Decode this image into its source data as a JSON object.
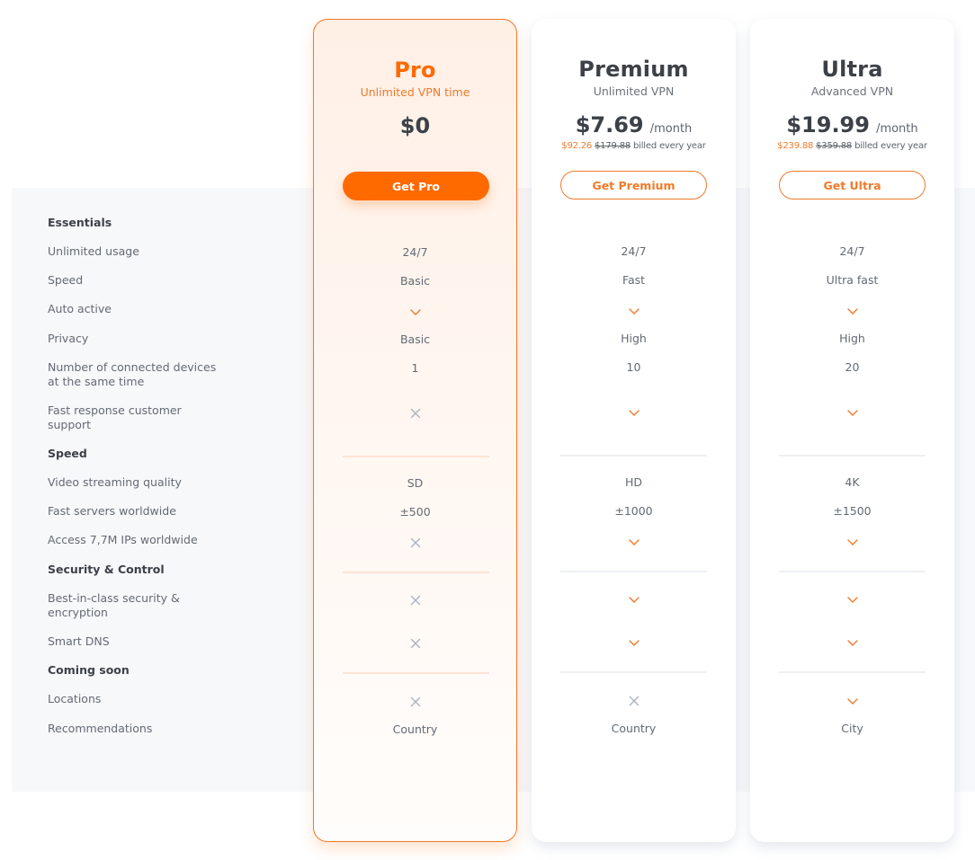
{
  "features": {
    "sections": [
      {
        "title": "Essentials",
        "rows": [
          {
            "label": "Unlimited usage"
          },
          {
            "label": "Speed"
          },
          {
            "label": "Auto active"
          },
          {
            "label": "Privacy"
          },
          {
            "label": "Number of connected devices at the same time"
          },
          {
            "label": "Fast response customer support"
          }
        ]
      },
      {
        "title": "Speed",
        "rows": [
          {
            "label": "Video streaming quality"
          },
          {
            "label": "Fast servers worldwide"
          },
          {
            "label": "Access 7,7M IPs worldwide"
          }
        ]
      },
      {
        "title": "Security & Control",
        "rows": [
          {
            "label": "Best-in-class security & encryption"
          },
          {
            "label": "Smart DNS"
          }
        ]
      },
      {
        "title": "Coming soon",
        "rows": [
          {
            "label": "Locations"
          },
          {
            "label": "Recommendations"
          }
        ]
      }
    ]
  },
  "plans": [
    {
      "name": "Pro",
      "subtitle": "Unlimited VPN time",
      "price": "$0",
      "per": "",
      "billing_sale": "",
      "billing_original": "",
      "billing_suffix": "",
      "cta": "Get Pro",
      "featured": true,
      "values": [
        "24/7",
        "Basic",
        "check-icon",
        "Basic",
        "1",
        "x-icon",
        "SD",
        "±500",
        "x-icon",
        "x-icon",
        "x-icon",
        "x-icon",
        "Country"
      ]
    },
    {
      "name": "Premium",
      "subtitle": "Unlimited VPN",
      "price": "$7.69",
      "per": "/month",
      "billing_sale": "$92.26",
      "billing_original": "$179.88",
      "billing_suffix": "billed every year",
      "cta": "Get Premium",
      "featured": false,
      "values": [
        "24/7",
        "Fast",
        "check-icon",
        "High",
        "10",
        "check-icon",
        "HD",
        "±1000",
        "check-icon",
        "check-icon",
        "check-icon",
        "x-icon",
        "Country"
      ]
    },
    {
      "name": "Ultra",
      "subtitle": "Advanced VPN",
      "price": "$19.99",
      "per": "/month",
      "billing_sale": "$239.88",
      "billing_original": "$359.88",
      "billing_suffix": "billed every year",
      "cta": "Get Ultra",
      "featured": false,
      "values": [
        "24/7",
        "Ultra fast",
        "check-icon",
        "High",
        "20",
        "check-icon",
        "4K",
        "±1500",
        "check-icon",
        "check-icon",
        "check-icon",
        "check-icon",
        "City"
      ]
    }
  ],
  "colors": {
    "accent": "#ff6a00",
    "accent_text": "#f07a2a",
    "check": "#f07a2a",
    "cross": "#a9b4c2",
    "text_dark": "#3c4148",
    "text_muted": "#636a74",
    "features_bg": "#f7f8fa"
  }
}
